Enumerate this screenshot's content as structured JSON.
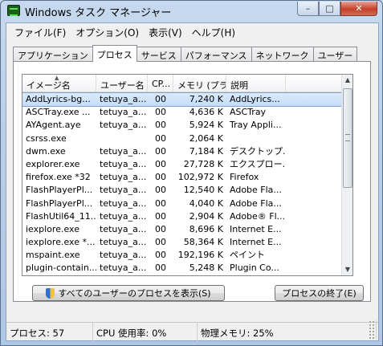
{
  "window": {
    "title": "Windows タスク マネージャー",
    "buttons": {
      "minimize": "–",
      "maximize": "□",
      "close": "✕"
    }
  },
  "menu": [
    "ファイル(F)",
    "オプション(O)",
    "表示(V)",
    "ヘルプ(H)"
  ],
  "tabs": [
    "アプリケーション",
    "プロセス",
    "サービス",
    "パフォーマンス",
    "ネットワーク",
    "ユーザー"
  ],
  "active_tab": "プロセス",
  "columns": [
    "イメージ名",
    "ユーザー名",
    "CP...",
    "メモリ (プラ...",
    "説明"
  ],
  "rows": [
    {
      "image": "AddLyrics-bg...",
      "user": "tetuya_a...",
      "cpu": "00",
      "mem": "7,240 K",
      "desc": "AddLyrics...",
      "selected": true
    },
    {
      "image": "ASCTray.exe ...",
      "user": "tetuya_a...",
      "cpu": "00",
      "mem": "4,636 K",
      "desc": "ASCTray"
    },
    {
      "image": "AYAgent.aye",
      "user": "tetuya_a...",
      "cpu": "00",
      "mem": "5,924 K",
      "desc": "Tray Appli..."
    },
    {
      "image": "csrss.exe",
      "user": "",
      "cpu": "00",
      "mem": "2,064 K",
      "desc": ""
    },
    {
      "image": "dwm.exe",
      "user": "tetuya_a...",
      "cpu": "00",
      "mem": "7,184 K",
      "desc": "デスクトップ..."
    },
    {
      "image": "explorer.exe",
      "user": "tetuya_a...",
      "cpu": "00",
      "mem": "27,728 K",
      "desc": "エクスプロー..."
    },
    {
      "image": "firefox.exe *32",
      "user": "tetuya_a...",
      "cpu": "00",
      "mem": "102,972 K",
      "desc": "Firefox"
    },
    {
      "image": "FlashPlayerPl...",
      "user": "tetuya_a...",
      "cpu": "00",
      "mem": "12,540 K",
      "desc": "Adobe Fla..."
    },
    {
      "image": "FlashPlayerPl...",
      "user": "tetuya_a...",
      "cpu": "00",
      "mem": "4,040 K",
      "desc": "Adobe Fla..."
    },
    {
      "image": "FlashUtil64_11...",
      "user": "tetuya_a...",
      "cpu": "00",
      "mem": "2,904 K",
      "desc": "Adobe® Fl..."
    },
    {
      "image": "iexplore.exe",
      "user": "tetuya_a...",
      "cpu": "00",
      "mem": "8,696 K",
      "desc": "Internet E..."
    },
    {
      "image": "iexplore.exe *...",
      "user": "tetuya_a...",
      "cpu": "00",
      "mem": "58,364 K",
      "desc": "Internet E..."
    },
    {
      "image": "mspaint.exe",
      "user": "tetuya_a...",
      "cpu": "00",
      "mem": "192,196 K",
      "desc": "ペイント"
    },
    {
      "image": "plugin-contain...",
      "user": "tetuya_a...",
      "cpu": "00",
      "mem": "5,248 K",
      "desc": "Plugin Co..."
    },
    {
      "image": "...",
      "user": "",
      "cpu": "",
      "mem": "",
      "desc": ""
    }
  ],
  "buttons": {
    "show_all": "すべてのユーザーのプロセスを表示(S)",
    "end_process": "プロセスの終了(E)"
  },
  "status": {
    "processes": "プロセス: 57",
    "cpu": "CPU 使用率: 0%",
    "memory": "物理メモリ: 25%"
  }
}
